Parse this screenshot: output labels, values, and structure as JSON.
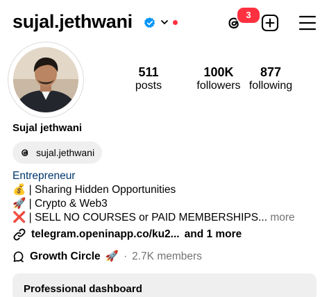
{
  "header": {
    "username": "sujal.jethwani",
    "verified_icon": "verified-badge-icon",
    "notification_count": "3",
    "accent_red": "#ff3040",
    "verified_blue": "#0095f6"
  },
  "profile": {
    "display_name": "Sujal jethwani",
    "stats": {
      "posts": {
        "value": "511",
        "label": "posts"
      },
      "followers": {
        "value": "100K",
        "label": "followers"
      },
      "following": {
        "value": "877",
        "label": "following"
      }
    },
    "threads_handle": "sujal.jethwani"
  },
  "bio": {
    "category": "Entrepreneur",
    "line1_emoji": "💰",
    "line1_text": " | Sharing Hidden Opportunities",
    "line2_emoji": "🚀",
    "line2_text": " | Crypto & Web3",
    "line3_emoji": "❌",
    "line3_text": " | SELL NO COURSES or PAID MEMBERSHIPS...",
    "more": " more"
  },
  "link": {
    "text": "telegram.openinapp.co/ku2...",
    "extra": "and 1 more"
  },
  "channel": {
    "name": "Growth Circle",
    "emoji": "🚀",
    "separator": "·",
    "members": "2.7K members"
  },
  "dashboard": {
    "title": "Professional dashboard"
  }
}
